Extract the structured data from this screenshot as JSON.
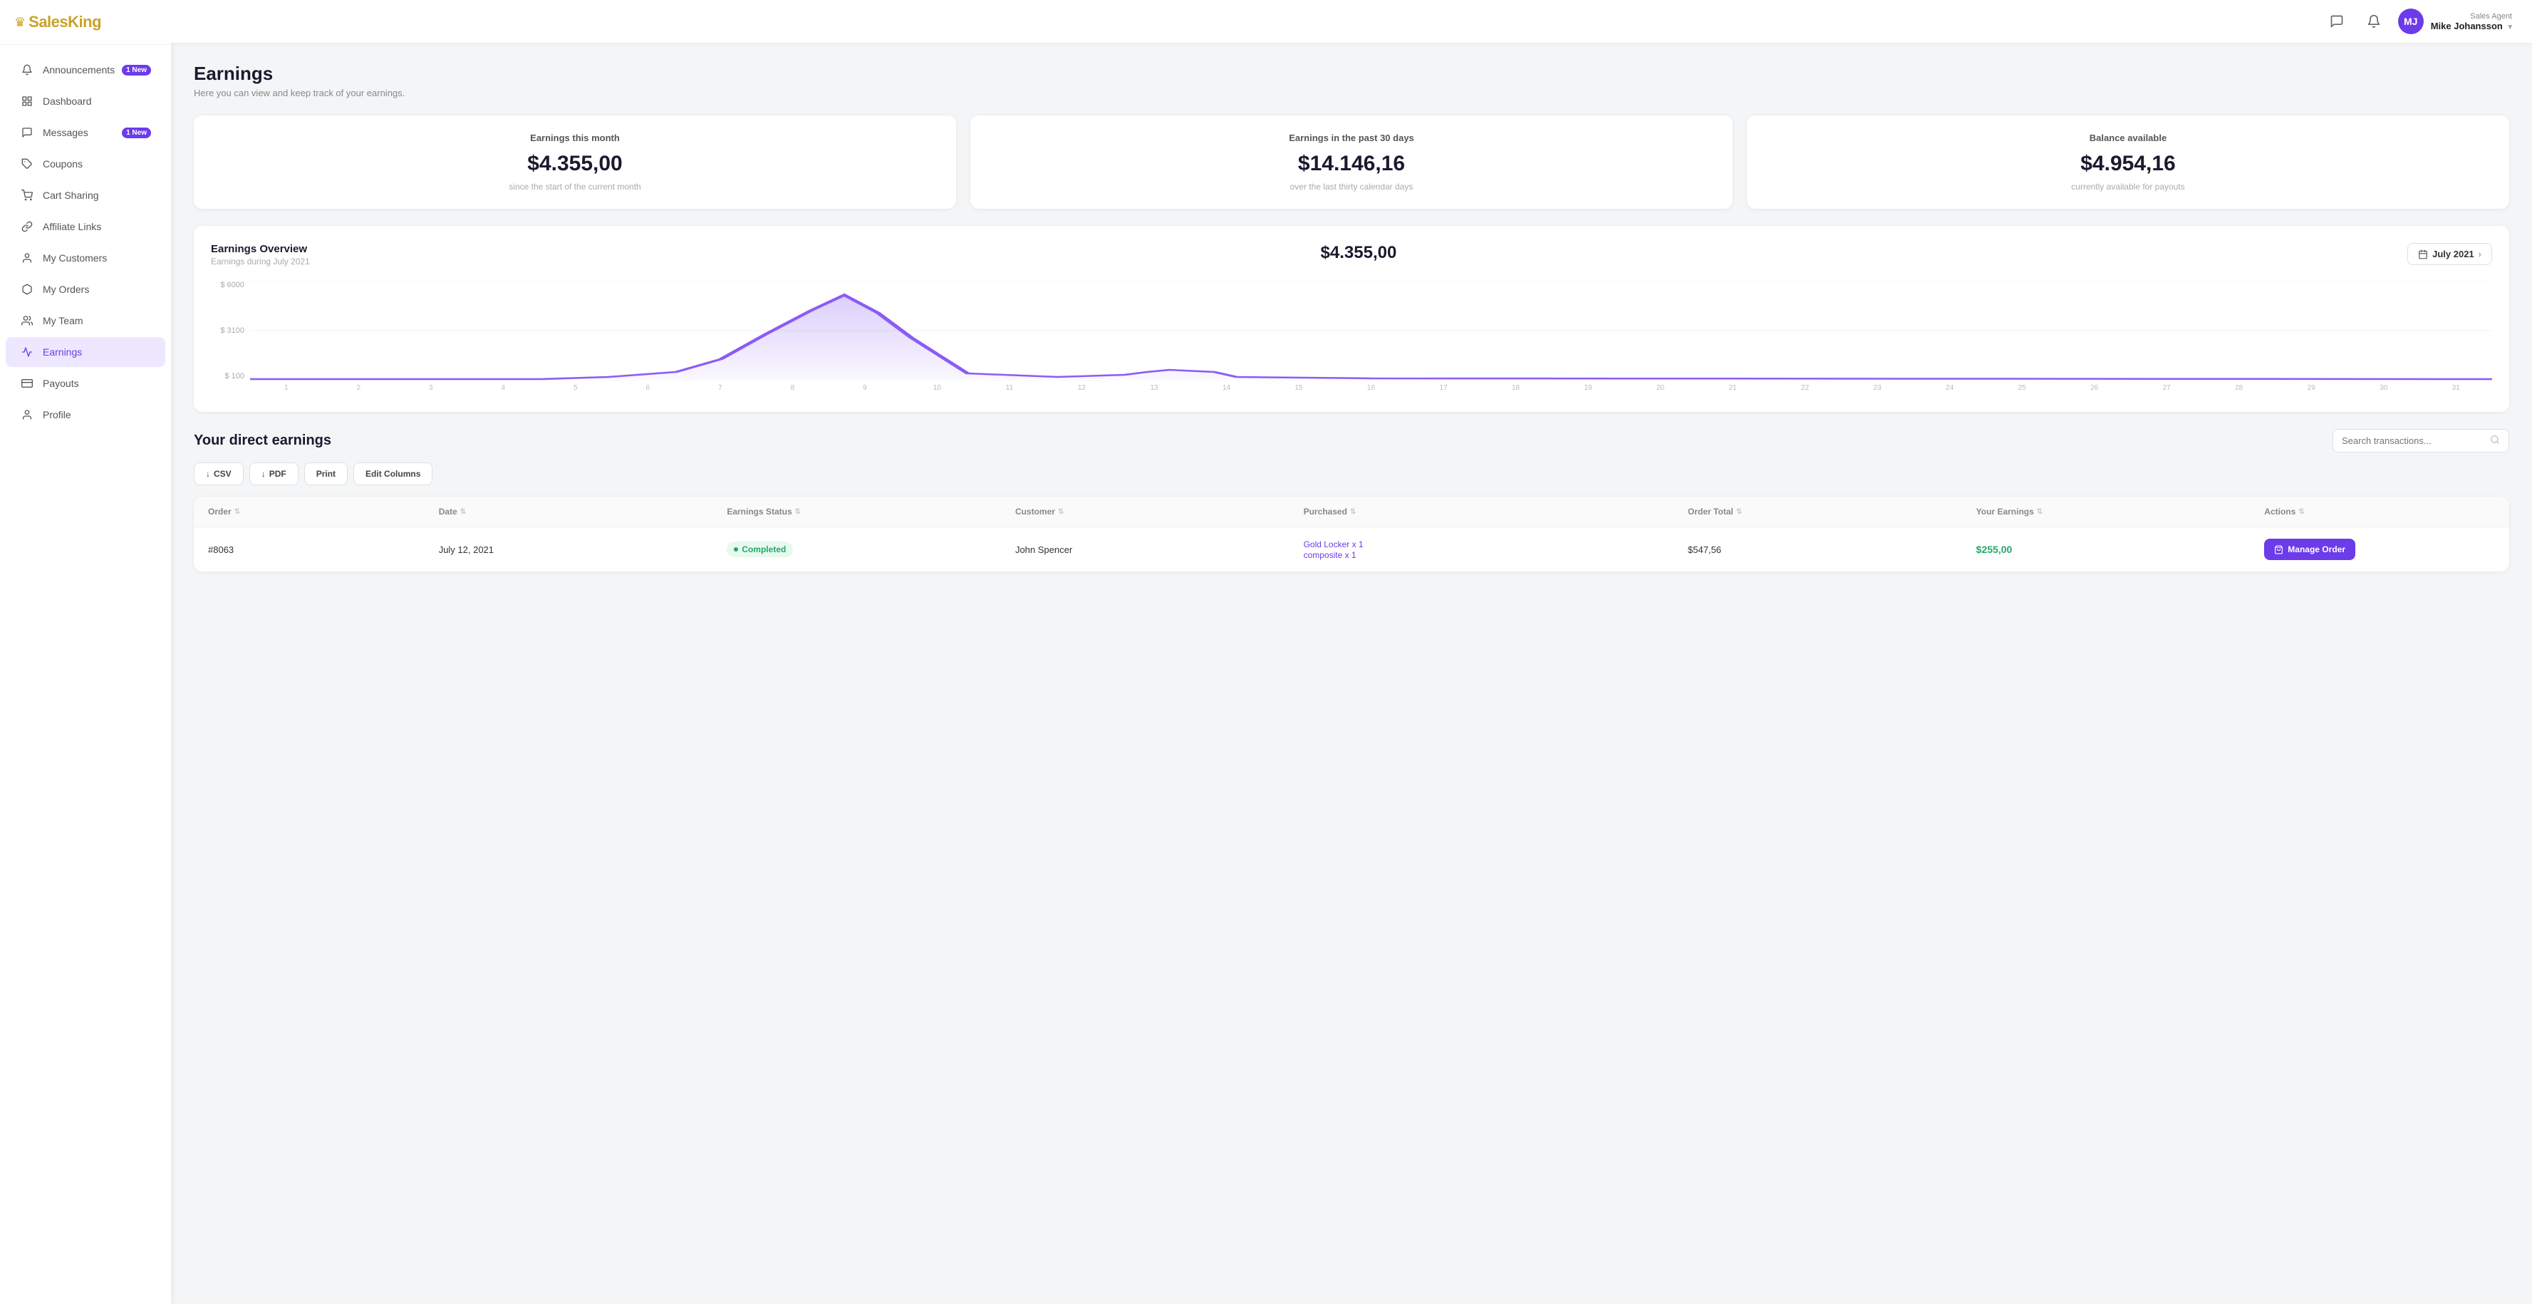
{
  "brand": {
    "name_part1": "Sales",
    "name_part2": "King",
    "crown": "♛"
  },
  "topbar": {
    "user_role": "Sales Agent",
    "user_name": "Mike Johansson",
    "user_initials": "MJ",
    "chevron": "▾",
    "chat_icon": "💬",
    "bell_icon": "🔔"
  },
  "sidebar": {
    "items": [
      {
        "id": "announcements",
        "label": "Announcements",
        "badge": "1 New",
        "icon": "bell"
      },
      {
        "id": "dashboard",
        "label": "Dashboard",
        "badge": null,
        "icon": "grid"
      },
      {
        "id": "messages",
        "label": "Messages",
        "badge": "1 New",
        "icon": "chat"
      },
      {
        "id": "coupons",
        "label": "Coupons",
        "badge": null,
        "icon": "tag"
      },
      {
        "id": "cart-sharing",
        "label": "Cart Sharing",
        "badge": null,
        "icon": "cart"
      },
      {
        "id": "affiliate-links",
        "label": "Affiliate Links",
        "badge": null,
        "icon": "link"
      },
      {
        "id": "my-customers",
        "label": "My Customers",
        "badge": null,
        "icon": "person"
      },
      {
        "id": "my-orders",
        "label": "My Orders",
        "badge": null,
        "icon": "box"
      },
      {
        "id": "my-team",
        "label": "My Team",
        "badge": null,
        "icon": "team"
      },
      {
        "id": "earnings",
        "label": "Earnings",
        "badge": null,
        "icon": "chart",
        "active": true
      },
      {
        "id": "payouts",
        "label": "Payouts",
        "badge": null,
        "icon": "wallet"
      },
      {
        "id": "profile",
        "label": "Profile",
        "badge": null,
        "icon": "user"
      }
    ]
  },
  "page": {
    "title": "Earnings",
    "subtitle": "Here you can view and keep track of your earnings."
  },
  "stats": [
    {
      "label": "Earnings this month",
      "value": "$4.355,00",
      "note": "since the start of the current month"
    },
    {
      "label": "Earnings in the past 30 days",
      "value": "$14.146,16",
      "note": "over the last thirty calendar days"
    },
    {
      "label": "Balance available",
      "value": "$4.954,16",
      "note": "currently available for payouts"
    }
  ],
  "overview": {
    "title": "Earnings Overview",
    "subtitle": "Earnings during July 2021",
    "total": "$4.355,00",
    "date_label": "July 2021",
    "y_labels": [
      "$ 6000",
      "$ 3100",
      "$ 100"
    ],
    "x_labels": [
      "1",
      "2",
      "3",
      "4",
      "5",
      "6",
      "7",
      "8",
      "9",
      "10",
      "11",
      "12",
      "13",
      "14",
      "15",
      "16",
      "17",
      "18",
      "19",
      "20",
      "21",
      "22",
      "23",
      "24",
      "25",
      "26",
      "27",
      "28",
      "29",
      "30",
      "31"
    ]
  },
  "direct_earnings": {
    "title": "Your direct earnings",
    "search_placeholder": "Search transactions...",
    "buttons": [
      {
        "id": "csv",
        "label": "↓ CSV"
      },
      {
        "id": "pdf",
        "label": "↓ PDF"
      },
      {
        "id": "print",
        "label": "Print"
      },
      {
        "id": "edit-cols",
        "label": "Edit Columns"
      }
    ],
    "columns": [
      "Order",
      "Date",
      "Earnings Status",
      "Customer",
      "Purchased",
      "Order Total",
      "Your Earnings",
      "Actions"
    ],
    "rows": [
      {
        "order": "#8063",
        "date": "July 12, 2021",
        "status": "Completed",
        "customer": "John Spencer",
        "purchased": "Gold Locker x 1\ncomposite x 1",
        "order_total": "$547,56",
        "your_earnings": "$255,00",
        "action": "Manage Order"
      }
    ]
  }
}
